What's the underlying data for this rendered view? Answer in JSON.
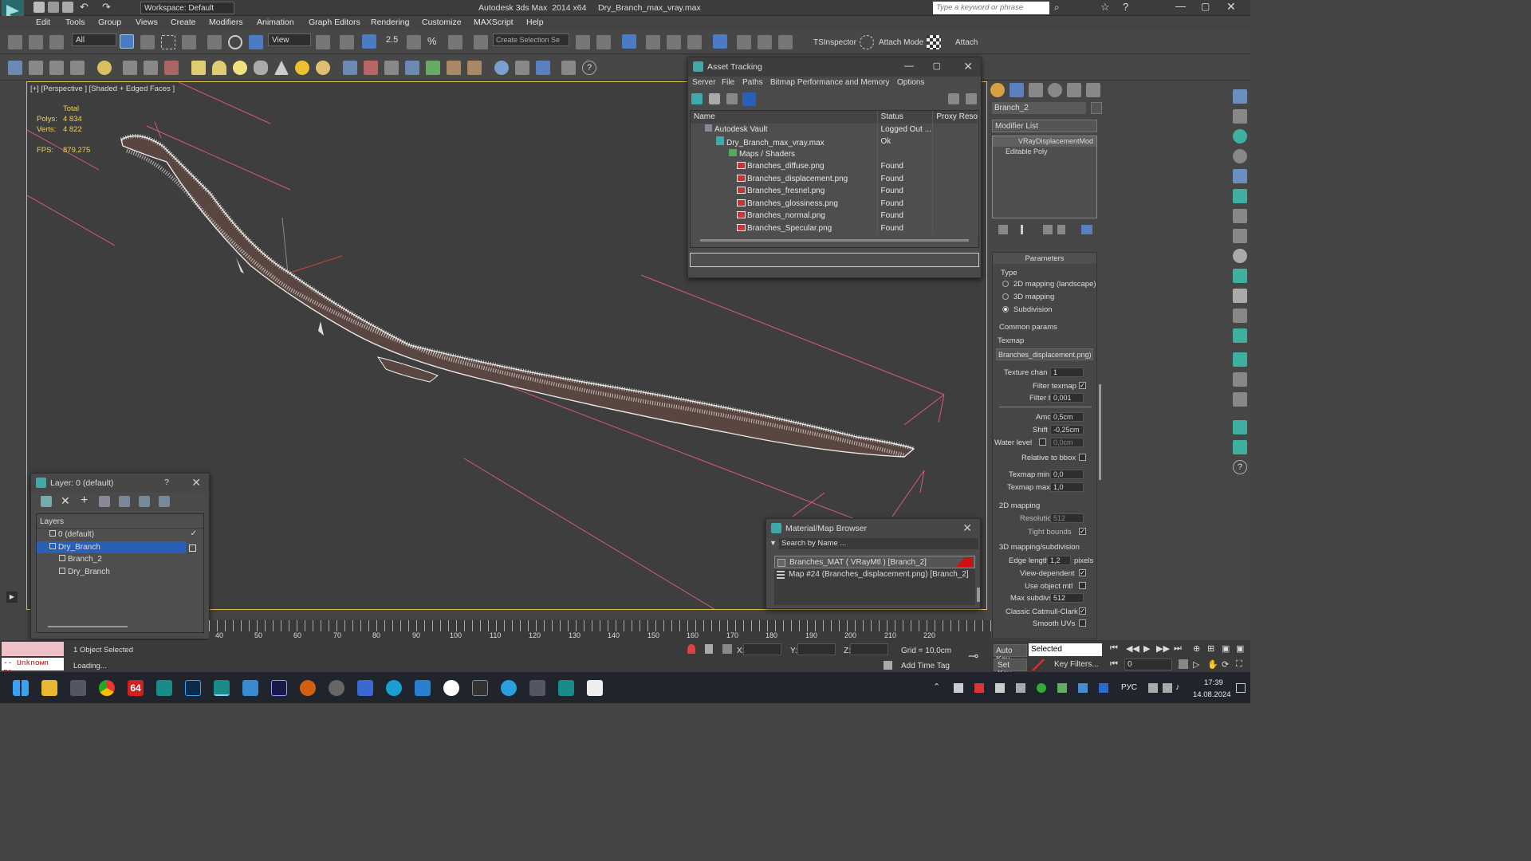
{
  "app": {
    "title": "Autodesk 3ds Max  2014 x64     Dry_Branch_max_vray.max",
    "workspace": "Workspace: Default",
    "search_placeholder": "Type a keyword or phrase"
  },
  "menus": [
    "Edit",
    "Tools",
    "Group",
    "Views",
    "Create",
    "Modifiers",
    "Animation",
    "Graph Editors",
    "Rendering",
    "Customize",
    "MAXScript",
    "Help"
  ],
  "toolbar": {
    "selection_filter": "All",
    "ref_coord": "View",
    "create_selection_set": "Create Selection Se",
    "tsinspector": "TSInspector",
    "attach_mode": "Attach Mode",
    "attach": "Attach",
    "snap_value": "2.5"
  },
  "viewport": {
    "label": "[+] [Perspective ] [Shaded + Edged Faces ]",
    "stats_total": "Total",
    "polys_label": "Polys:",
    "polys_value": "4 834",
    "verts_label": "Verts:",
    "verts_value": "4 822",
    "fps_label": "FPS:",
    "fps_value": "879,275"
  },
  "asset_tracking": {
    "title": "Asset Tracking",
    "menus": [
      "Server",
      "File",
      "Paths",
      "Bitmap Performance and Memory",
      "Options"
    ],
    "columns": [
      "Name",
      "Status",
      "Proxy Reso"
    ],
    "rows": [
      {
        "name": "Autodesk Vault",
        "status": "Logged Out ...",
        "indent": 1
      },
      {
        "name": "Dry_Branch_max_vray.max",
        "status": "Ok",
        "indent": 2
      },
      {
        "name": "Maps / Shaders",
        "status": "",
        "indent": 3
      },
      {
        "name": "Branches_diffuse.png",
        "status": "Found",
        "indent": 4
      },
      {
        "name": "Branches_displacement.png",
        "status": "Found",
        "indent": 4
      },
      {
        "name": "Branches_fresnel.png",
        "status": "Found",
        "indent": 4
      },
      {
        "name": "Branches_glossiness.png",
        "status": "Found",
        "indent": 4
      },
      {
        "name": "Branches_normal.png",
        "status": "Found",
        "indent": 4
      },
      {
        "name": "Branches_Specular.png",
        "status": "Found",
        "indent": 4
      }
    ]
  },
  "layer_window": {
    "title": "Layer: 0 (default)",
    "header": "Layers",
    "items": [
      {
        "label": "0 (default)",
        "level": 0,
        "selected": false
      },
      {
        "label": "Dry_Branch",
        "level": 0,
        "selected": true
      },
      {
        "label": "Branch_2",
        "level": 1,
        "selected": false
      },
      {
        "label": "Dry_Branch",
        "level": 1,
        "selected": false
      }
    ]
  },
  "mat_browser": {
    "title": "Material/Map Browser",
    "search_placeholder": "Search by Name ...",
    "items": [
      "Branches_MAT  ( VRayMtl )  [Branch_2]",
      "Map #24 (Branches_displacement.png)  [Branch_2]"
    ]
  },
  "command_panel": {
    "object_name": "Branch_2",
    "modifier_list": "Modifier List",
    "stack": [
      "VRayDisplacementMod",
      "Editable Poly"
    ],
    "rollout": "Parameters",
    "type_label": "Type",
    "type_options": [
      "2D mapping (landscape)",
      "3D mapping",
      "Subdivision"
    ],
    "common_params": "Common params",
    "texmap_label": "Texmap",
    "texmap_value": "Branches_displacement.png)",
    "texture_chan_label": "Texture chan",
    "texture_chan_value": "1",
    "filter_texmap_label": "Filter texmap",
    "filter_blur_label": "Filter blur",
    "filter_blur_value": "0,001",
    "amount_label": "Amount",
    "amount_value": "0,5cm",
    "shift_label": "Shift",
    "shift_value": "-0,25cm",
    "water_level_label": "Water level",
    "water_level_value": "0,0cm",
    "relative_bbox_label": "Relative to bbox",
    "texmap_min_label": "Texmap min",
    "texmap_min_value": "0,0",
    "texmap_max_label": "Texmap max",
    "texmap_max_value": "1,0",
    "mapping2d_label": "2D mapping",
    "resolution_label": "Resolution",
    "resolution_value": "512",
    "tight_bounds_label": "Tight bounds",
    "mapping3d_label": "3D mapping/subdivision",
    "edge_length_label": "Edge length",
    "edge_length_value": "1,2",
    "pixels_label": "pixels",
    "view_dependent_label": "View-dependent",
    "use_object_mtl_label": "Use object mtl",
    "max_subdivs_label": "Max subdivs",
    "max_subdivs_value": "512",
    "catmull_label": "Classic Catmull-Clark",
    "smooth_uvs_label": "Smooth UVs"
  },
  "timeline": {
    "ticks": [
      "40",
      "50",
      "60",
      "70",
      "80",
      "90",
      "100",
      "110",
      "120",
      "130",
      "140",
      "150",
      "160",
      "170",
      "180",
      "190",
      "200",
      "210",
      "220"
    ]
  },
  "status": {
    "selected": "1 Object Selected",
    "loading": "Loading...",
    "unknown": "-- Unknown p:",
    "x_label": "X:",
    "y_label": "Y:",
    "z_label": "Z:",
    "grid": "Grid = 10,0cm",
    "add_time_tag": "Add Time Tag",
    "auto_key": "Auto Key",
    "set_key": "Set Key",
    "key_mode": "Selected",
    "key_filters": "Key Filters...",
    "frame": "0"
  },
  "taskbar": {
    "lang": "РУС",
    "time": "17:39",
    "date": "14.08.2024",
    "badge": "64"
  },
  "colors": {
    "accent_blue": "#2a5fb8",
    "frame_yellow": "#e0c050",
    "pink_lines": "#d85a7a"
  }
}
